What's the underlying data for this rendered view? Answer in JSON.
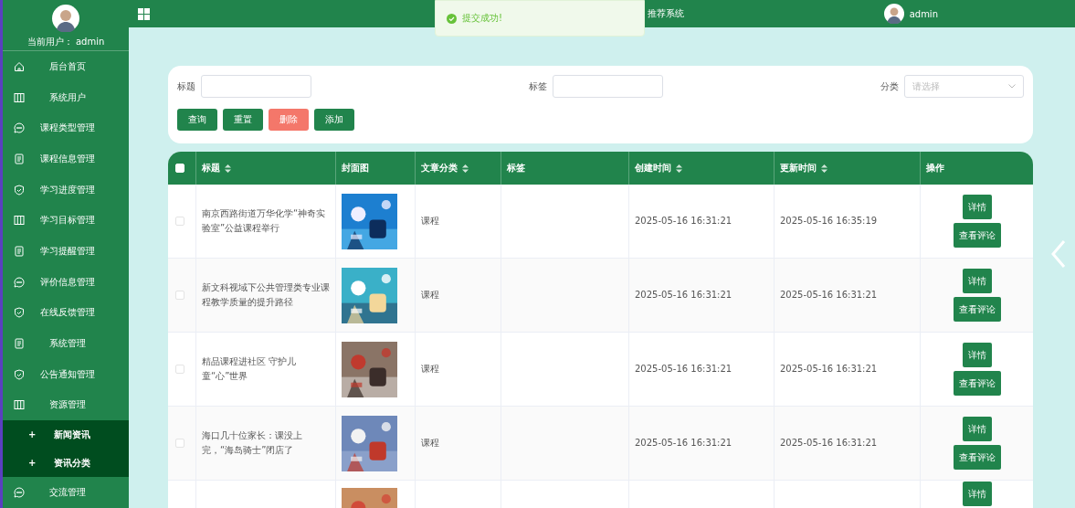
{
  "sidebar": {
    "current_user_label": "当前用户：",
    "current_user": "admin",
    "items": [
      {
        "label": "后台首页"
      },
      {
        "label": "系统用户"
      },
      {
        "label": "课程类型管理"
      },
      {
        "label": "课程信息管理"
      },
      {
        "label": "学习进度管理"
      },
      {
        "label": "学习目标管理"
      },
      {
        "label": "学习提醒管理"
      },
      {
        "label": "评价信息管理"
      },
      {
        "label": "在线反馈管理"
      },
      {
        "label": "系统管理"
      },
      {
        "label": "公告通知管理"
      },
      {
        "label": "资源管理",
        "expanded": true,
        "children": [
          {
            "label": "新闻资讯",
            "expander": "+"
          },
          {
            "label": "资讯分类",
            "expander": "+"
          }
        ]
      },
      {
        "label": "交流管理"
      }
    ]
  },
  "header": {
    "title": "推荐系统",
    "user": "admin"
  },
  "toast": {
    "message": "提交成功!"
  },
  "search": {
    "fields": [
      {
        "label": "标题",
        "kind": "input"
      },
      {
        "label": "标签",
        "kind": "input"
      },
      {
        "label": "分类",
        "kind": "select",
        "placeholder": "请选择"
      }
    ],
    "buttons": [
      {
        "label": "查询",
        "kind": "primary"
      },
      {
        "label": "重置",
        "kind": "primary"
      },
      {
        "label": "删除",
        "kind": "danger"
      },
      {
        "label": "添加",
        "kind": "primary"
      }
    ]
  },
  "table": {
    "header_checked": false,
    "columns": [
      {
        "label": "标题",
        "sortable": true
      },
      {
        "label": "封面图",
        "sortable": false
      },
      {
        "label": "文章分类",
        "sortable": true
      },
      {
        "label": "标签",
        "sortable": false
      },
      {
        "label": "创建时间",
        "sortable": true
      },
      {
        "label": "更新时间",
        "sortable": true
      },
      {
        "label": "操作",
        "sortable": false
      }
    ],
    "rows": [
      {
        "checked": false,
        "title": "南京西路街道万华化学“神奇实验室”公益课程举行",
        "cover": {
          "kind": "picture"
        },
        "category": "课程",
        "created": "2025-05-16 16:31:21",
        "updated": "2025-05-16 16:35:19",
        "actions": [
          "详情",
          "查看评论"
        ]
      },
      {
        "checked": false,
        "title": "新文科视域下公共管理类专业课程教学质量的提升路径",
        "cover": {
          "kind": "picture"
        },
        "category": "课程",
        "created": "2025-05-16 16:31:21",
        "updated": "2025-05-16 16:31:21",
        "actions": [
          "详情",
          "查看评论"
        ]
      },
      {
        "checked": false,
        "title": "精品课程进社区 守护儿童“心”世界",
        "cover": {
          "kind": "picture"
        },
        "category": "课程",
        "created": "2025-05-16 16:31:21",
        "updated": "2025-05-16 16:31:21",
        "actions": [
          "详情",
          "查看评论"
        ]
      },
      {
        "checked": false,
        "title": "海口几十位家长：课没上完，“海岛骑士”闭店了",
        "cover": {
          "kind": "picture"
        },
        "category": "课程",
        "created": "2025-05-16 16:31:21",
        "updated": "2025-05-16 16:31:21",
        "actions": [
          "详情",
          "查看评论"
        ]
      },
      {
        "cover": {
          "kind": "picture"
        },
        "actions": [
          "详情"
        ]
      }
    ]
  }
}
